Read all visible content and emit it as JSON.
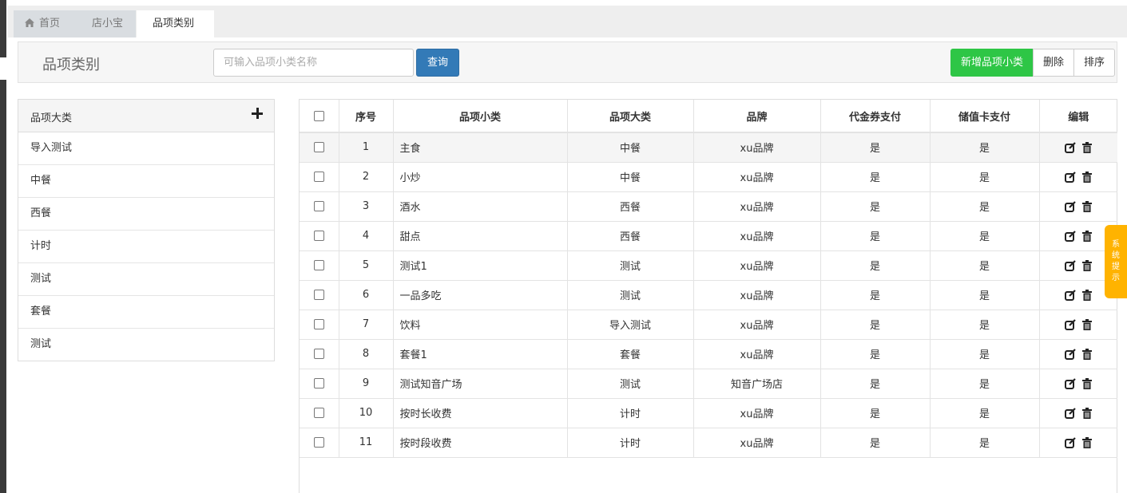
{
  "tabs": [
    {
      "label": "首页",
      "icon": "home-icon"
    },
    {
      "label": "店小宝"
    },
    {
      "label": "品项类别",
      "active": true
    }
  ],
  "toolbar": {
    "title": "品项类别",
    "search_placeholder": "可输入品项小类名称",
    "query_label": "查询",
    "add_label": "新增品项小类",
    "delete_label": "删除",
    "sort_label": "排序"
  },
  "category_panel": {
    "header": "品项大类",
    "items": [
      "导入测试",
      "中餐",
      "西餐",
      "计时",
      "测试",
      "套餐",
      "测试"
    ]
  },
  "table": {
    "columns": [
      "序号",
      "品项小类",
      "品项大类",
      "品牌",
      "代金券支付",
      "储值卡支付",
      "编辑"
    ],
    "rows": [
      {
        "no": "1",
        "sub": "主食",
        "cat": "中餐",
        "brand": "xu品牌",
        "voucher": "是",
        "card": "是"
      },
      {
        "no": "2",
        "sub": "小炒",
        "cat": "中餐",
        "brand": "xu品牌",
        "voucher": "是",
        "card": "是"
      },
      {
        "no": "3",
        "sub": "酒水",
        "cat": "西餐",
        "brand": "xu品牌",
        "voucher": "是",
        "card": "是"
      },
      {
        "no": "4",
        "sub": "甜点",
        "cat": "西餐",
        "brand": "xu品牌",
        "voucher": "是",
        "card": "是"
      },
      {
        "no": "5",
        "sub": "测试1",
        "cat": "测试",
        "brand": "xu品牌",
        "voucher": "是",
        "card": "是"
      },
      {
        "no": "6",
        "sub": "一品多吃",
        "cat": "测试",
        "brand": "xu品牌",
        "voucher": "是",
        "card": "是"
      },
      {
        "no": "7",
        "sub": "饮料",
        "cat": "导入测试",
        "brand": "xu品牌",
        "voucher": "是",
        "card": "是"
      },
      {
        "no": "8",
        "sub": "套餐1",
        "cat": "套餐",
        "brand": "xu品牌",
        "voucher": "是",
        "card": "是"
      },
      {
        "no": "9",
        "sub": "测试知音广场",
        "cat": "测试",
        "brand": "知音广场店",
        "voucher": "是",
        "card": "是"
      },
      {
        "no": "10",
        "sub": "按时长收费",
        "cat": "计时",
        "brand": "xu品牌",
        "voucher": "是",
        "card": "是"
      },
      {
        "no": "11",
        "sub": "按时段收费",
        "cat": "计时",
        "brand": "xu品牌",
        "voucher": "是",
        "card": "是"
      }
    ]
  },
  "system_tip": [
    "系",
    "统",
    "提",
    "示"
  ],
  "colors": {
    "primary": "#337ab7",
    "success": "#2ec646",
    "tip": "#ffb300"
  }
}
